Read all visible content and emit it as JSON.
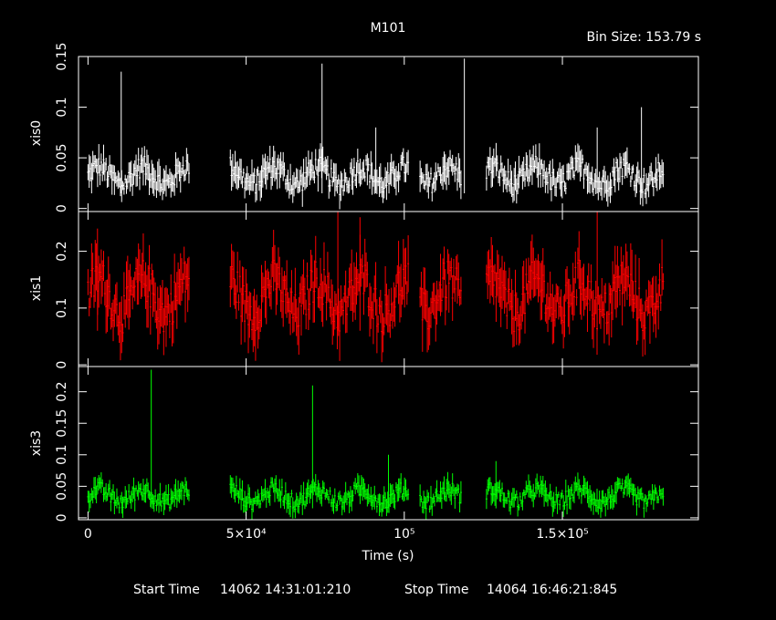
{
  "title": "M101",
  "bin_size_label": "Bin Size: 153.79 s",
  "footer": {
    "start_label": "Start Time",
    "start_value": "14062 14:31:01:210",
    "stop_label": "Stop Time",
    "stop_value": "14064 16:46:21:845"
  },
  "colors": {
    "background": "#000000",
    "axes": "#ffffff",
    "xis0": "#ffffff",
    "xis1": "#ff0000",
    "xis3": "#00ff00"
  },
  "chart_data": {
    "type": "scatter",
    "title": "M101",
    "xlabel": "Time (s)",
    "xlim": [
      -3000,
      193000
    ],
    "x_ticks": [
      {
        "value": 0,
        "label": "0"
      },
      {
        "value": 50000,
        "label": "5×10⁴"
      },
      {
        "value": 100000,
        "label": "10⁵"
      },
      {
        "value": 150000,
        "label": "1.5×10⁵"
      }
    ],
    "observation_windows_s": [
      [
        0,
        32000
      ],
      [
        45000,
        101500
      ],
      [
        105000,
        118000
      ],
      [
        126000,
        182000
      ]
    ],
    "series": [
      {
        "name": "xis0",
        "ylabel": "xis0",
        "color": "#ffffff",
        "ylim": [
          -0.003,
          0.15
        ],
        "y_ticks": [
          {
            "value": 0,
            "label": "0"
          },
          {
            "value": 0.05,
            "label": "0.05"
          },
          {
            "value": 0.1,
            "label": "0.1"
          },
          {
            "value": 0.15,
            "label": "0.15"
          }
        ],
        "typical_range": [
          0.015,
          0.05
        ],
        "spikes": [
          [
            10500,
            0.135
          ],
          [
            74000,
            0.143
          ],
          [
            91000,
            0.08
          ],
          [
            119000,
            0.148
          ],
          [
            161000,
            0.08
          ],
          [
            175000,
            0.1
          ]
        ]
      },
      {
        "name": "xis1",
        "ylabel": "xis1",
        "color": "#ff0000",
        "ylim": [
          -0.003,
          0.27
        ],
        "y_ticks": [
          {
            "value": 0,
            "label": "0"
          },
          {
            "value": 0.1,
            "label": "0.1"
          },
          {
            "value": 0.2,
            "label": "0.2"
          }
        ],
        "typical_range": [
          0.06,
          0.18
        ],
        "spikes": [
          [
            3000,
            0.24
          ],
          [
            79000,
            0.27
          ],
          [
            86000,
            0.26
          ],
          [
            161000,
            0.27
          ]
        ]
      },
      {
        "name": "xis3",
        "ylabel": "xis3",
        "color": "#00ff00",
        "ylim": [
          -0.003,
          0.24
        ],
        "y_ticks": [
          {
            "value": 0,
            "label": "0"
          },
          {
            "value": 0.05,
            "label": "0.05"
          },
          {
            "value": 0.1,
            "label": "0.1"
          },
          {
            "value": 0.15,
            "label": "0.15"
          },
          {
            "value": 0.2,
            "label": "0.2"
          }
        ],
        "typical_range": [
          0.015,
          0.055
        ],
        "spikes": [
          [
            20000,
            0.235
          ],
          [
            71000,
            0.21
          ],
          [
            95000,
            0.1
          ],
          [
            129000,
            0.09
          ]
        ]
      }
    ]
  }
}
